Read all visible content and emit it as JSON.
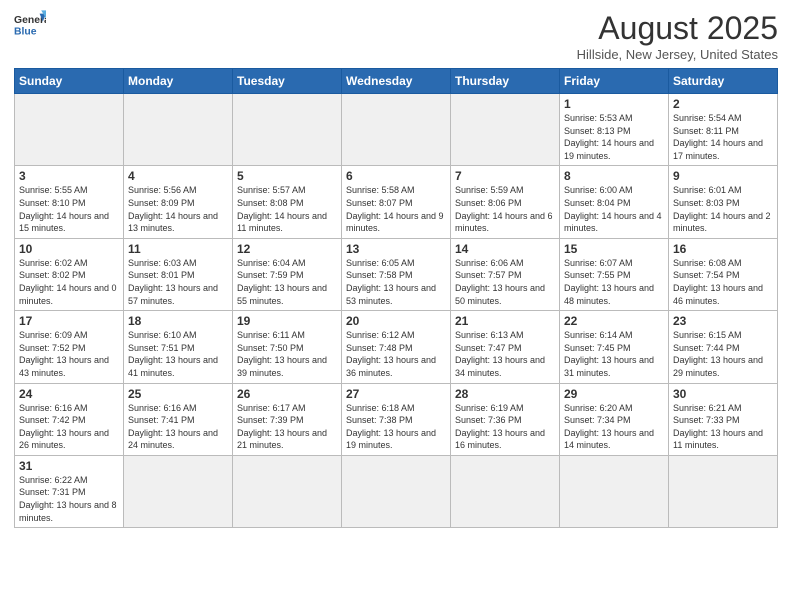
{
  "logo": {
    "text_general": "General",
    "text_blue": "Blue"
  },
  "title": "August 2025",
  "subtitle": "Hillside, New Jersey, United States",
  "weekdays": [
    "Sunday",
    "Monday",
    "Tuesday",
    "Wednesday",
    "Thursday",
    "Friday",
    "Saturday"
  ],
  "weeks": [
    [
      {
        "date": "",
        "info": ""
      },
      {
        "date": "",
        "info": ""
      },
      {
        "date": "",
        "info": ""
      },
      {
        "date": "",
        "info": ""
      },
      {
        "date": "",
        "info": ""
      },
      {
        "date": "1",
        "info": "Sunrise: 5:53 AM\nSunset: 8:13 PM\nDaylight: 14 hours and 19 minutes."
      },
      {
        "date": "2",
        "info": "Sunrise: 5:54 AM\nSunset: 8:11 PM\nDaylight: 14 hours and 17 minutes."
      }
    ],
    [
      {
        "date": "3",
        "info": "Sunrise: 5:55 AM\nSunset: 8:10 PM\nDaylight: 14 hours and 15 minutes."
      },
      {
        "date": "4",
        "info": "Sunrise: 5:56 AM\nSunset: 8:09 PM\nDaylight: 14 hours and 13 minutes."
      },
      {
        "date": "5",
        "info": "Sunrise: 5:57 AM\nSunset: 8:08 PM\nDaylight: 14 hours and 11 minutes."
      },
      {
        "date": "6",
        "info": "Sunrise: 5:58 AM\nSunset: 8:07 PM\nDaylight: 14 hours and 9 minutes."
      },
      {
        "date": "7",
        "info": "Sunrise: 5:59 AM\nSunset: 8:06 PM\nDaylight: 14 hours and 6 minutes."
      },
      {
        "date": "8",
        "info": "Sunrise: 6:00 AM\nSunset: 8:04 PM\nDaylight: 14 hours and 4 minutes."
      },
      {
        "date": "9",
        "info": "Sunrise: 6:01 AM\nSunset: 8:03 PM\nDaylight: 14 hours and 2 minutes."
      }
    ],
    [
      {
        "date": "10",
        "info": "Sunrise: 6:02 AM\nSunset: 8:02 PM\nDaylight: 14 hours and 0 minutes."
      },
      {
        "date": "11",
        "info": "Sunrise: 6:03 AM\nSunset: 8:01 PM\nDaylight: 13 hours and 57 minutes."
      },
      {
        "date": "12",
        "info": "Sunrise: 6:04 AM\nSunset: 7:59 PM\nDaylight: 13 hours and 55 minutes."
      },
      {
        "date": "13",
        "info": "Sunrise: 6:05 AM\nSunset: 7:58 PM\nDaylight: 13 hours and 53 minutes."
      },
      {
        "date": "14",
        "info": "Sunrise: 6:06 AM\nSunset: 7:57 PM\nDaylight: 13 hours and 50 minutes."
      },
      {
        "date": "15",
        "info": "Sunrise: 6:07 AM\nSunset: 7:55 PM\nDaylight: 13 hours and 48 minutes."
      },
      {
        "date": "16",
        "info": "Sunrise: 6:08 AM\nSunset: 7:54 PM\nDaylight: 13 hours and 46 minutes."
      }
    ],
    [
      {
        "date": "17",
        "info": "Sunrise: 6:09 AM\nSunset: 7:52 PM\nDaylight: 13 hours and 43 minutes."
      },
      {
        "date": "18",
        "info": "Sunrise: 6:10 AM\nSunset: 7:51 PM\nDaylight: 13 hours and 41 minutes."
      },
      {
        "date": "19",
        "info": "Sunrise: 6:11 AM\nSunset: 7:50 PM\nDaylight: 13 hours and 39 minutes."
      },
      {
        "date": "20",
        "info": "Sunrise: 6:12 AM\nSunset: 7:48 PM\nDaylight: 13 hours and 36 minutes."
      },
      {
        "date": "21",
        "info": "Sunrise: 6:13 AM\nSunset: 7:47 PM\nDaylight: 13 hours and 34 minutes."
      },
      {
        "date": "22",
        "info": "Sunrise: 6:14 AM\nSunset: 7:45 PM\nDaylight: 13 hours and 31 minutes."
      },
      {
        "date": "23",
        "info": "Sunrise: 6:15 AM\nSunset: 7:44 PM\nDaylight: 13 hours and 29 minutes."
      }
    ],
    [
      {
        "date": "24",
        "info": "Sunrise: 6:16 AM\nSunset: 7:42 PM\nDaylight: 13 hours and 26 minutes."
      },
      {
        "date": "25",
        "info": "Sunrise: 6:16 AM\nSunset: 7:41 PM\nDaylight: 13 hours and 24 minutes."
      },
      {
        "date": "26",
        "info": "Sunrise: 6:17 AM\nSunset: 7:39 PM\nDaylight: 13 hours and 21 minutes."
      },
      {
        "date": "27",
        "info": "Sunrise: 6:18 AM\nSunset: 7:38 PM\nDaylight: 13 hours and 19 minutes."
      },
      {
        "date": "28",
        "info": "Sunrise: 6:19 AM\nSunset: 7:36 PM\nDaylight: 13 hours and 16 minutes."
      },
      {
        "date": "29",
        "info": "Sunrise: 6:20 AM\nSunset: 7:34 PM\nDaylight: 13 hours and 14 minutes."
      },
      {
        "date": "30",
        "info": "Sunrise: 6:21 AM\nSunset: 7:33 PM\nDaylight: 13 hours and 11 minutes."
      }
    ],
    [
      {
        "date": "31",
        "info": "Sunrise: 6:22 AM\nSunset: 7:31 PM\nDaylight: 13 hours and 8 minutes."
      },
      {
        "date": "",
        "info": ""
      },
      {
        "date": "",
        "info": ""
      },
      {
        "date": "",
        "info": ""
      },
      {
        "date": "",
        "info": ""
      },
      {
        "date": "",
        "info": ""
      },
      {
        "date": "",
        "info": ""
      }
    ]
  ]
}
